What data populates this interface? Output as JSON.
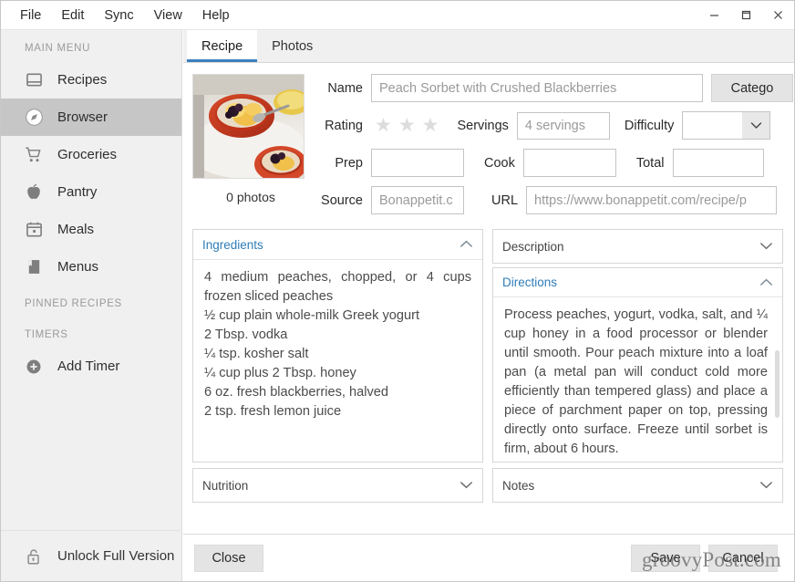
{
  "window": {
    "menus": [
      "File",
      "Edit",
      "Sync",
      "View",
      "Help"
    ],
    "controls": {
      "minimize": "minimize-icon",
      "maximize": "maximize-icon",
      "close": "close-icon"
    }
  },
  "sidebar": {
    "sections": [
      {
        "label": "MAIN MENU"
      },
      {
        "label": "PINNED RECIPES"
      },
      {
        "label": "TIMERS"
      }
    ],
    "items": [
      {
        "label": "Recipes",
        "icon": "inbox-icon",
        "active": false
      },
      {
        "label": "Browser",
        "icon": "compass-icon",
        "active": true
      },
      {
        "label": "Groceries",
        "icon": "cart-icon",
        "active": false
      },
      {
        "label": "Pantry",
        "icon": "apple-icon",
        "active": false
      },
      {
        "label": "Meals",
        "icon": "calendar-icon",
        "active": false
      },
      {
        "label": "Menus",
        "icon": "book-icon",
        "active": false
      }
    ],
    "timers": {
      "add_label": "Add Timer",
      "icon": "plus-circle-icon"
    },
    "unlock": {
      "label": "Unlock Full Version",
      "icon": "unlock-icon"
    }
  },
  "tabs": [
    {
      "label": "Recipe",
      "active": true
    },
    {
      "label": "Photos",
      "active": false
    }
  ],
  "photo": {
    "count_label": "0 photos",
    "alt": "peach sorbet with blackberries in red bowls"
  },
  "form": {
    "name_label": "Name",
    "name_value": "Peach Sorbet with Crushed Blackberries",
    "category_button": "Catego",
    "rating_label": "Rating",
    "rating_stars": 3,
    "rating_filled": 0,
    "servings_label": "Servings",
    "servings_value": "4 servings",
    "difficulty_label": "Difficulty",
    "difficulty_value": "",
    "prep_label": "Prep",
    "prep_value": "",
    "cook_label": "Cook",
    "cook_value": "",
    "total_label": "Total",
    "total_value": "",
    "source_label": "Source",
    "source_value": "Bonappetit.c",
    "url_label": "URL",
    "url_value": "https://www.bonappetit.com/recipe/p"
  },
  "panels": {
    "ingredients": {
      "title": "Ingredients",
      "expanded": true,
      "text": "4 medium peaches, chopped, or 4 cups frozen sliced peaches\n½ cup plain whole-milk Greek yogurt\n2 Tbsp. vodka\n¼ tsp. kosher salt\n¼ cup plus 2 Tbsp. honey\n6 oz. fresh blackberries, halved\n2 tsp. fresh lemon juice"
    },
    "nutrition": {
      "title": "Nutrition",
      "expanded": false
    },
    "description": {
      "title": "Description",
      "expanded": false
    },
    "directions": {
      "title": "Directions",
      "expanded": true,
      "text": "Process peaches, yogurt, vodka, salt, and ¼ cup honey in a food processor or blender until smooth. Pour peach mixture into a loaf pan (a metal pan will conduct cold more efficiently than tempered glass) and place a piece of parchment paper on top, pressing directly onto surface. Freeze until sorbet is firm, about 6 hours."
    },
    "notes": {
      "title": "Notes",
      "expanded": false
    }
  },
  "footer": {
    "close_label": "Close",
    "save_label": "Save",
    "cancel_label": "Cancel",
    "watermark": "groovyPost.com"
  },
  "colors": {
    "accent_blue": "#3c7fc0",
    "panel_title_blue": "#2e7db8",
    "sidebar_bg": "#f0f0f0",
    "selected_item_bg": "#c6c6c6",
    "button_grey": "#e4e4e4"
  }
}
